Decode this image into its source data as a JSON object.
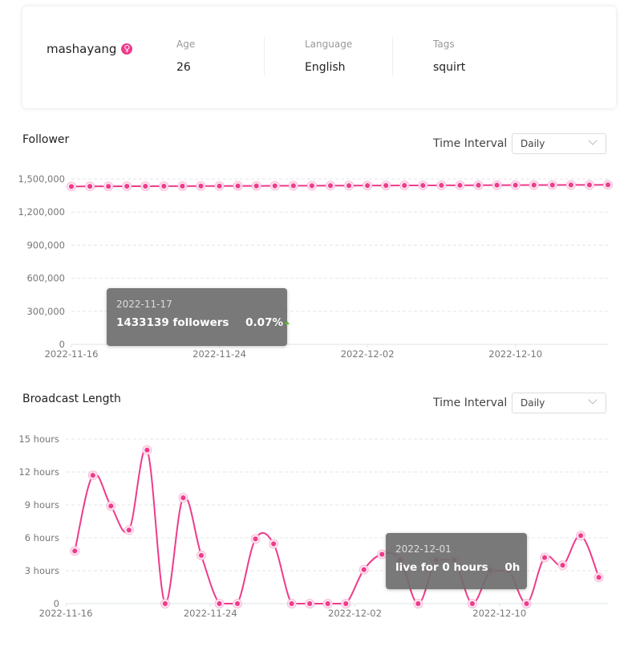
{
  "profile": {
    "username": "mashayang",
    "gender_icon": "female-icon",
    "gender_symbol": "♀",
    "stats": [
      {
        "label": "Age",
        "value": "26"
      },
      {
        "label": "Language",
        "value": "English"
      },
      {
        "label": "Tags",
        "value": "squirt"
      }
    ]
  },
  "colors": {
    "accent": "#ee3b8b",
    "tooltip_bg": "#6e6e6e",
    "up": "#52c41a"
  },
  "follower": {
    "title": "Follower",
    "interval_label": "Time Interval",
    "interval_value": "Daily",
    "tooltip": {
      "date": "2022-11-17",
      "text": "1433139 followers",
      "change": "0.07%",
      "trend": "up"
    }
  },
  "broadcast": {
    "title": "Broadcast Length",
    "interval_label": "Time Interval",
    "interval_value": "Daily",
    "tooltip": {
      "date": "2022-12-01",
      "text": "live for 0 hours",
      "value": "0h"
    }
  },
  "chart_data": [
    {
      "type": "line",
      "start_date": "2022-11-16",
      "x_ticks": [
        "2022-11-16",
        "2022-11-24",
        "2022-12-02",
        "2022-12-10"
      ],
      "y_ticks": [
        "0",
        "300,000",
        "600,000",
        "900,000",
        "1,200,000",
        "1,500,000"
      ],
      "ylim": [
        0,
        1500000
      ],
      "grid": true,
      "values": [
        1432150,
        1433139,
        1433600,
        1434100,
        1434600,
        1435100,
        1435600,
        1436100,
        1436600,
        1437100,
        1437600,
        1438100,
        1438600,
        1439100,
        1439600,
        1440100,
        1440600,
        1441100,
        1441600,
        1442100,
        1442600,
        1443100,
        1443600,
        1444100,
        1444600,
        1445100,
        1445600,
        1446100,
        1446600,
        1447100
      ]
    },
    {
      "type": "line",
      "smooth": true,
      "start_date": "2022-11-16",
      "x_ticks": [
        "2022-11-16",
        "2022-11-24",
        "2022-12-02",
        "2022-12-10"
      ],
      "y_ticks": [
        "0",
        "3 hours",
        "6 hours",
        "9 hours",
        "12 hours",
        "15 hours"
      ],
      "ylim": [
        0,
        15
      ],
      "grid": true,
      "unit": "hours",
      "values": [
        4.8,
        11.7,
        8.9,
        6.7,
        14.0,
        0,
        9.65,
        4.4,
        0,
        0,
        5.9,
        5.45,
        0,
        0,
        0,
        0,
        3.1,
        4.5,
        4.0,
        0,
        4.0,
        4.0,
        0,
        3.0,
        3.0,
        0,
        4.2,
        3.5,
        6.2,
        2.4
      ]
    }
  ]
}
